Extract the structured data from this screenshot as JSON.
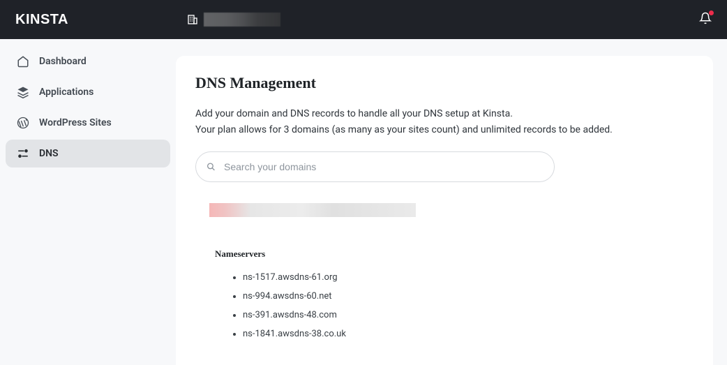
{
  "brand": "KINSTA",
  "sidebar": {
    "items": [
      {
        "label": "Dashboard"
      },
      {
        "label": "Applications"
      },
      {
        "label": "WordPress Sites"
      },
      {
        "label": "DNS"
      }
    ]
  },
  "page": {
    "title": "DNS Management",
    "desc_line1": "Add your domain and DNS records to handle all your DNS setup at Kinsta.",
    "desc_line2": "Your plan allows for 3 domains (as many as your sites count) and unlimited records to be added."
  },
  "search": {
    "placeholder": "Search your domains"
  },
  "nameservers": {
    "heading": "Nameservers",
    "list": [
      "ns-1517.awsdns-61.org",
      "ns-994.awsdns-60.net",
      "ns-391.awsdns-48.com",
      "ns-1841.awsdns-38.co.uk"
    ]
  }
}
